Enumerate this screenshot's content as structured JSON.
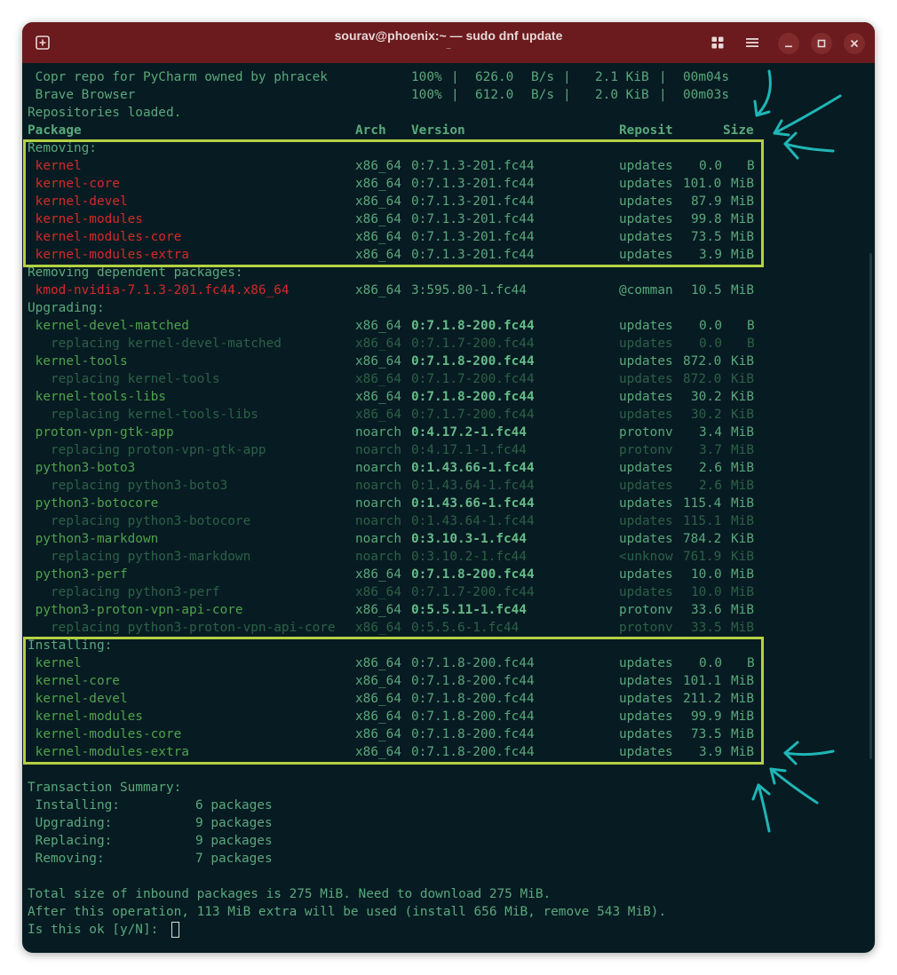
{
  "window": {
    "title": "sourav@phoenix:~ — sudo dnf update",
    "subtitle": "~"
  },
  "icons": {
    "new_tab": "plus-square-icon",
    "tabs_overview": "grid-icon",
    "menu": "hamburger-menu-icon",
    "minimize": "minimize-icon",
    "maximize": "maximize-icon",
    "close": "close-icon"
  },
  "colors": {
    "titlebar": "#6b1a1d",
    "terminal_bg": "#071b22",
    "highlight": "#b4d142",
    "arrow": "#1fb5b5"
  },
  "terminal": {
    "lines": [
      {
        "kind": "repo",
        "name": " Copr repo for PyCharm owned by phracek",
        "pct": "100%",
        "speed": "626.0",
        "unit": "B/s",
        "size": "2.1 KiB",
        "time": "00m04s"
      },
      {
        "kind": "repo",
        "name": " Brave Browser",
        "pct": "100%",
        "speed": "612.0",
        "unit": "B/s",
        "size": "2.0 KiB",
        "time": "00m03s"
      },
      {
        "kind": "text",
        "text": "Repositories loaded."
      },
      {
        "kind": "header",
        "c1": "Package",
        "c2": "Arch",
        "c3": "Version",
        "c4": "Reposit",
        "c5": "Size"
      },
      {
        "kind": "section",
        "text": "Removing:"
      },
      {
        "kind": "pkg",
        "style": "red",
        "name": " kernel",
        "arch": "x86_64",
        "ver": "0:7.1.3-201.fc44",
        "repo": "updates",
        "size": "0.0",
        "unit": "B"
      },
      {
        "kind": "pkg",
        "style": "red",
        "name": " kernel-core",
        "arch": "x86_64",
        "ver": "0:7.1.3-201.fc44",
        "repo": "updates",
        "size": "101.0",
        "unit": "MiB"
      },
      {
        "kind": "pkg",
        "style": "red",
        "name": " kernel-devel",
        "arch": "x86_64",
        "ver": "0:7.1.3-201.fc44",
        "repo": "updates",
        "size": "87.9",
        "unit": "MiB"
      },
      {
        "kind": "pkg",
        "style": "red",
        "name": " kernel-modules",
        "arch": "x86_64",
        "ver": "0:7.1.3-201.fc44",
        "repo": "updates",
        "size": "99.8",
        "unit": "MiB"
      },
      {
        "kind": "pkg",
        "style": "red",
        "name": " kernel-modules-core",
        "arch": "x86_64",
        "ver": "0:7.1.3-201.fc44",
        "repo": "updates",
        "size": "73.5",
        "unit": "MiB"
      },
      {
        "kind": "pkg",
        "style": "red",
        "name": " kernel-modules-extra",
        "arch": "x86_64",
        "ver": "0:7.1.3-201.fc44",
        "repo": "updates",
        "size": "3.9",
        "unit": "MiB"
      },
      {
        "kind": "section",
        "text": "Removing dependent packages:"
      },
      {
        "kind": "pkg",
        "style": "red",
        "name": " kmod-nvidia-7.1.3-201.fc44.x86_64",
        "arch": "x86_64",
        "ver": "3:595.80-1.fc44",
        "repo": "@comman",
        "size": "10.5",
        "unit": "MiB"
      },
      {
        "kind": "section",
        "text": "Upgrading:"
      },
      {
        "kind": "pkg",
        "style": "up",
        "name": " kernel-devel-matched",
        "arch": "x86_64",
        "ver": "0:7.1.8-200.fc44",
        "repo": "updates",
        "size": "0.0",
        "unit": "B"
      },
      {
        "kind": "pkg",
        "style": "dim",
        "name": "   replacing kernel-devel-matched",
        "arch": "x86_64",
        "ver": "0:7.1.7-200.fc44",
        "repo": "updates",
        "size": "0.0",
        "unit": "B"
      },
      {
        "kind": "pkg",
        "style": "up",
        "name": " kernel-tools",
        "arch": "x86_64",
        "ver": "0:7.1.8-200.fc44",
        "repo": "updates",
        "size": "872.0",
        "unit": "KiB"
      },
      {
        "kind": "pkg",
        "style": "dim",
        "name": "   replacing kernel-tools",
        "arch": "x86_64",
        "ver": "0:7.1.7-200.fc44",
        "repo": "updates",
        "size": "872.0",
        "unit": "KiB"
      },
      {
        "kind": "pkg",
        "style": "up",
        "name": " kernel-tools-libs",
        "arch": "x86_64",
        "ver": "0:7.1.8-200.fc44",
        "repo": "updates",
        "size": "30.2",
        "unit": "KiB"
      },
      {
        "kind": "pkg",
        "style": "dim",
        "name": "   replacing kernel-tools-libs",
        "arch": "x86_64",
        "ver": "0:7.1.7-200.fc44",
        "repo": "updates",
        "size": "30.2",
        "unit": "KiB"
      },
      {
        "kind": "pkg",
        "style": "up",
        "name": " proton-vpn-gtk-app",
        "arch": "noarch",
        "ver": "0:4.17.2-1.fc44",
        "repo": "protonv",
        "size": "3.4",
        "unit": "MiB"
      },
      {
        "kind": "pkg",
        "style": "dim",
        "name": "   replacing proton-vpn-gtk-app",
        "arch": "noarch",
        "ver": "0:4.17.1-1.fc44",
        "repo": "protonv",
        "size": "3.7",
        "unit": "MiB"
      },
      {
        "kind": "pkg",
        "style": "up",
        "name": " python3-boto3",
        "arch": "noarch",
        "ver": "0:1.43.66-1.fc44",
        "repo": "updates",
        "size": "2.6",
        "unit": "MiB"
      },
      {
        "kind": "pkg",
        "style": "dim",
        "name": "   replacing python3-boto3",
        "arch": "noarch",
        "ver": "0:1.43.64-1.fc44",
        "repo": "updates",
        "size": "2.6",
        "unit": "MiB"
      },
      {
        "kind": "pkg",
        "style": "up",
        "name": " python3-botocore",
        "arch": "noarch",
        "ver": "0:1.43.66-1.fc44",
        "repo": "updates",
        "size": "115.4",
        "unit": "MiB"
      },
      {
        "kind": "pkg",
        "style": "dim",
        "name": "   replacing python3-botocore",
        "arch": "noarch",
        "ver": "0:1.43.64-1.fc44",
        "repo": "updates",
        "size": "115.1",
        "unit": "MiB"
      },
      {
        "kind": "pkg",
        "style": "up",
        "name": " python3-markdown",
        "arch": "noarch",
        "ver": "0:3.10.3-1.fc44",
        "repo": "updates",
        "size": "784.2",
        "unit": "KiB"
      },
      {
        "kind": "pkg",
        "style": "dim",
        "name": "   replacing python3-markdown",
        "arch": "noarch",
        "ver": "0:3.10.2-1.fc44",
        "repo": "<unknow",
        "size": "761.9",
        "unit": "KiB"
      },
      {
        "kind": "pkg",
        "style": "up",
        "name": " python3-perf",
        "arch": "x86_64",
        "ver": "0:7.1.8-200.fc44",
        "repo": "updates",
        "size": "10.0",
        "unit": "MiB"
      },
      {
        "kind": "pkg",
        "style": "dim",
        "name": "   replacing python3-perf",
        "arch": "x86_64",
        "ver": "0:7.1.7-200.fc44",
        "repo": "updates",
        "size": "10.0",
        "unit": "MiB"
      },
      {
        "kind": "pkg",
        "style": "up",
        "name": " python3-proton-vpn-api-core",
        "arch": "x86_64",
        "ver": "0:5.5.11-1.fc44",
        "repo": "protonv",
        "size": "33.6",
        "unit": "MiB"
      },
      {
        "kind": "pkg",
        "style": "dim",
        "name": "   replacing python3-proton-vpn-api-core",
        "arch": "x86_64",
        "ver": "0:5.5.6-1.fc44",
        "repo": "protonv",
        "size": "33.5",
        "unit": "MiB"
      },
      {
        "kind": "section",
        "text": "Installing:"
      },
      {
        "kind": "pkg",
        "style": "inst",
        "name": " kernel",
        "arch": "x86_64",
        "ver": "0:7.1.8-200.fc44",
        "repo": "updates",
        "size": "0.0",
        "unit": "B"
      },
      {
        "kind": "pkg",
        "style": "inst",
        "name": " kernel-core",
        "arch": "x86_64",
        "ver": "0:7.1.8-200.fc44",
        "repo": "updates",
        "size": "101.1",
        "unit": "MiB"
      },
      {
        "kind": "pkg",
        "style": "inst",
        "name": " kernel-devel",
        "arch": "x86_64",
        "ver": "0:7.1.8-200.fc44",
        "repo": "updates",
        "size": "211.2",
        "unit": "MiB"
      },
      {
        "kind": "pkg",
        "style": "inst",
        "name": " kernel-modules",
        "arch": "x86_64",
        "ver": "0:7.1.8-200.fc44",
        "repo": "updates",
        "size": "99.9",
        "unit": "MiB"
      },
      {
        "kind": "pkg",
        "style": "inst",
        "name": " kernel-modules-core",
        "arch": "x86_64",
        "ver": "0:7.1.8-200.fc44",
        "repo": "updates",
        "size": "73.5",
        "unit": "MiB"
      },
      {
        "kind": "pkg",
        "style": "inst",
        "name": " kernel-modules-extra",
        "arch": "x86_64",
        "ver": "0:7.1.8-200.fc44",
        "repo": "updates",
        "size": "3.9",
        "unit": "MiB"
      },
      {
        "kind": "blank"
      },
      {
        "kind": "text",
        "text": "Transaction Summary:"
      },
      {
        "kind": "summary",
        "label": " Installing:",
        "value": "6 packages"
      },
      {
        "kind": "summary",
        "label": " Upgrading:",
        "value": "9 packages"
      },
      {
        "kind": "summary",
        "label": " Replacing:",
        "value": "9 packages"
      },
      {
        "kind": "summary",
        "label": " Removing:",
        "value": "7 packages"
      },
      {
        "kind": "blank"
      },
      {
        "kind": "text",
        "text": "Total size of inbound packages is 275 MiB. Need to download 275 MiB."
      },
      {
        "kind": "text",
        "text": "After this operation, 113 MiB extra will be used (install 656 MiB, remove 543 MiB)."
      },
      {
        "kind": "prompt",
        "text": "Is this ok [y/N]: "
      }
    ]
  }
}
